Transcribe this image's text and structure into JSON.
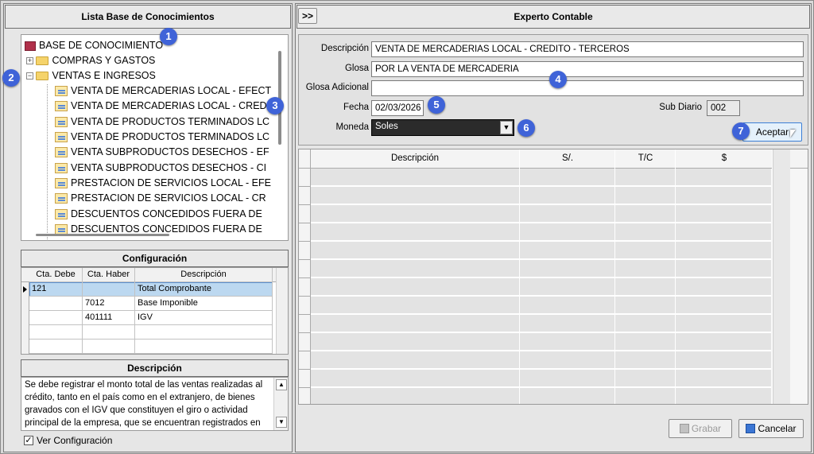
{
  "left_panel": {
    "title": "Lista Base de Conocimientos"
  },
  "tree": {
    "root": "BASE DE CONOCIMIENTO",
    "compras": "COMPRAS Y GASTOS",
    "ventas": "VENTAS E INGRESOS",
    "items": [
      "VENTA DE MERCADERIAS LOCAL - EFECT",
      "VENTA DE MERCADERIAS LOCAL - CRED",
      "VENTA DE PRODUCTOS TERMINADOS LC",
      "VENTA DE PRODUCTOS TERMINADOS LC",
      "VENTA SUBPRODUCTOS DESECHOS - EF",
      "VENTA SUBPRODUCTOS DESECHOS - CI",
      "PRESTACION DE SERVICIOS LOCAL - EFE",
      "PRESTACION DE SERVICIOS LOCAL - CR",
      "DESCUENTOS CONCEDIDOS FUERA DE",
      "DESCUENTOS CONCEDIDOS FUERA DE"
    ]
  },
  "config": {
    "title": "Configuración",
    "headers": [
      "Cta. Debe",
      "Cta. Haber",
      "Descripción"
    ],
    "rows": [
      {
        "debe": "121",
        "haber": "",
        "desc": "Total Comprobante"
      },
      {
        "debe": "",
        "haber": "7012",
        "desc": "Base Imponible"
      },
      {
        "debe": "",
        "haber": "401111",
        "desc": "IGV"
      }
    ]
  },
  "descripcion": {
    "title": "Descripción",
    "lines": [
      "Se debe registrar el monto total de las ventas realizadas al",
      "crédito, tanto en el país como en el extranjero, de bienes",
      "gravados con el IGV que constituyen el giro o actividad",
      "principal de la empresa, que se encuentran registrados en"
    ]
  },
  "ver_config": {
    "label": "Ver Configuración",
    "checked": true
  },
  "right_panel": {
    "title": "Experto Contable",
    "toggle": ">>"
  },
  "form": {
    "descripcion_label": "Descripción",
    "descripcion_value": "VENTA DE MERCADERIAS LOCAL - CREDITO - TERCEROS",
    "glosa_label": "Glosa",
    "glosa_value": "POR LA VENTA DE MERCADERIA",
    "glosa_adicional_label": "Glosa Adicional",
    "glosa_adicional_value": "",
    "fecha_label": "Fecha",
    "fecha_value": "02/03/2026",
    "subdiario_label": "Sub Diario",
    "subdiario_value": "002",
    "moneda_label": "Moneda",
    "moneda_value": "Soles",
    "aceptar": "Aceptar"
  },
  "grid": {
    "headers": [
      "Descripción",
      "S/.",
      "T/C",
      "$"
    ]
  },
  "footer": {
    "grabar": "Grabar",
    "cancelar": "Cancelar"
  },
  "badges": [
    "1",
    "2",
    "3",
    "4",
    "5",
    "6",
    "7"
  ],
  "colors": {
    "badge": "#3f63d8",
    "selected_row": "#bcd8f0",
    "combo": "#2b2b2b"
  }
}
